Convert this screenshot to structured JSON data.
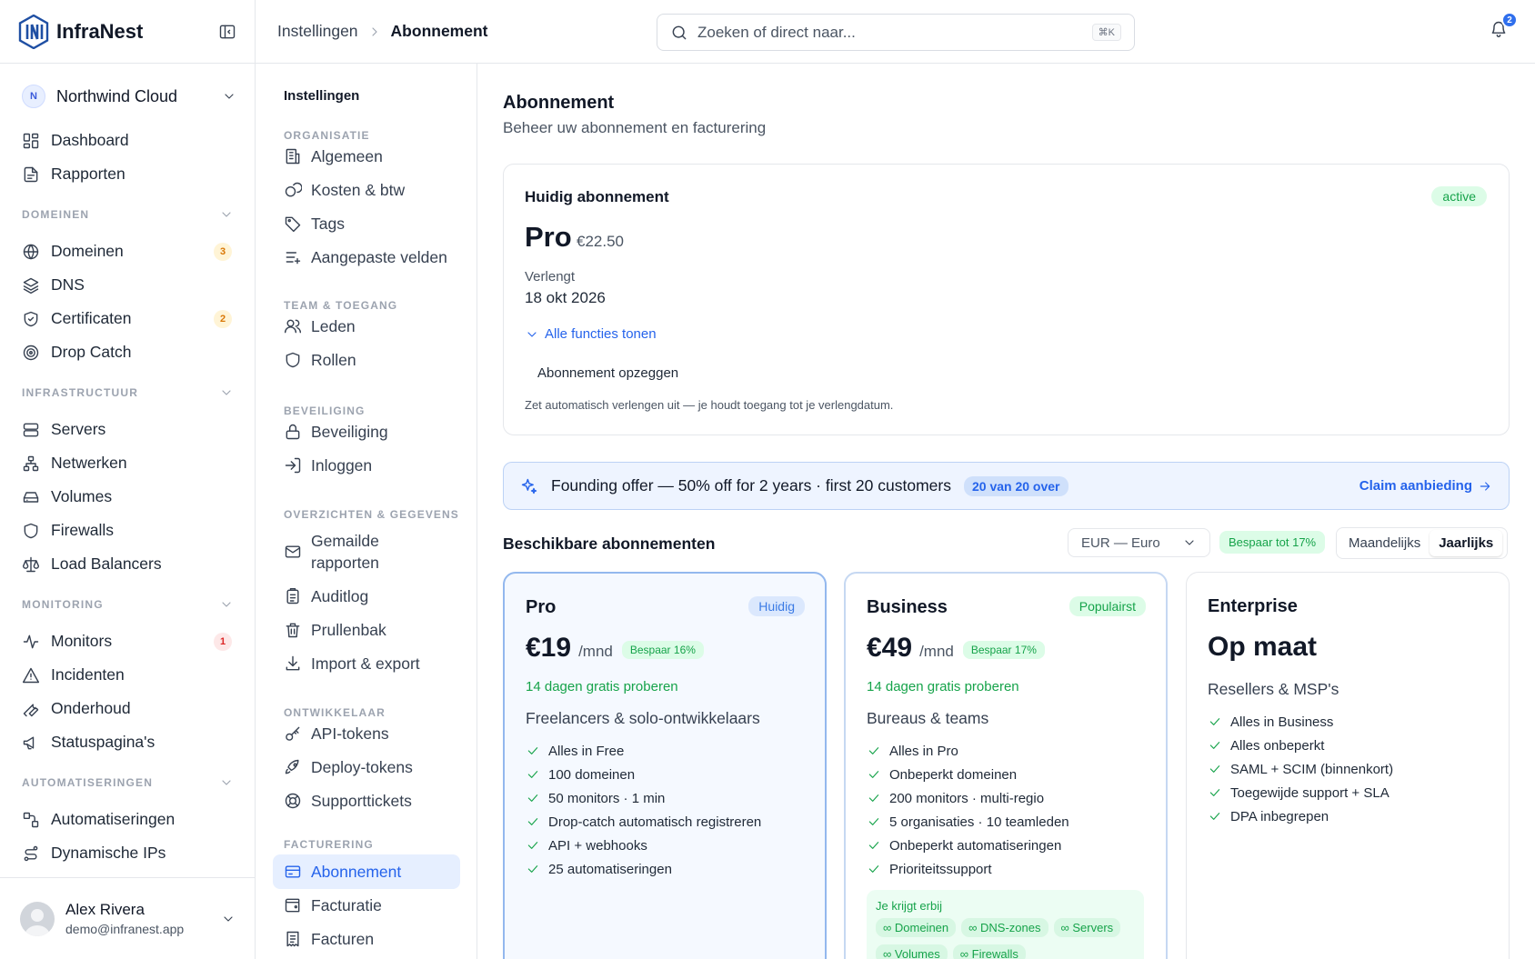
{
  "app": {
    "name": "InfraNest"
  },
  "org": {
    "initial": "N",
    "name": "Northwind Cloud"
  },
  "sidebar": {
    "top": [
      {
        "label": "Dashboard",
        "icon": "dashboard-icon"
      },
      {
        "label": "Rapporten",
        "icon": "report-icon"
      }
    ],
    "sections": [
      {
        "title": "DOMEINEN",
        "items": [
          {
            "label": "Domeinen",
            "icon": "globe-icon",
            "count": "3",
            "count_color": "orange"
          },
          {
            "label": "DNS",
            "icon": "layers-icon"
          },
          {
            "label": "Certificaten",
            "icon": "shield-check-icon",
            "count": "2",
            "count_color": "orange"
          },
          {
            "label": "Drop Catch",
            "icon": "target-icon"
          }
        ]
      },
      {
        "title": "INFRASTRUCTUUR",
        "items": [
          {
            "label": "Servers",
            "icon": "server-icon"
          },
          {
            "label": "Netwerken",
            "icon": "network-icon"
          },
          {
            "label": "Volumes",
            "icon": "hard-drive-icon"
          },
          {
            "label": "Firewalls",
            "icon": "shield-icon"
          },
          {
            "label": "Load Balancers",
            "icon": "scale-icon"
          }
        ]
      },
      {
        "title": "MONITORING",
        "items": [
          {
            "label": "Monitors",
            "icon": "activity-icon",
            "count": "1",
            "count_color": "red"
          },
          {
            "label": "Incidenten",
            "icon": "alert-triangle-icon"
          },
          {
            "label": "Onderhoud",
            "icon": "wrench-icon"
          },
          {
            "label": "Statuspagina's",
            "icon": "megaphone-icon"
          }
        ]
      },
      {
        "title": "AUTOMATISERINGEN",
        "items": [
          {
            "label": "Automatiseringen",
            "icon": "workflow-icon"
          },
          {
            "label": "Dynamische IPs",
            "icon": "route-icon"
          }
        ]
      }
    ]
  },
  "user": {
    "name": "Alex Rivera",
    "email": "demo@infranest.app"
  },
  "header": {
    "breadcrumb": [
      "Instellingen",
      "Abonnement"
    ],
    "search_placeholder": "Zoeken of direct naar...",
    "search_kbd": "⌘K",
    "notifications": "2"
  },
  "subnav": {
    "title": "Instellingen",
    "sections": [
      {
        "title": "ORGANISATIE",
        "items": [
          {
            "label": "Algemeen",
            "icon": "building-icon"
          },
          {
            "label": "Kosten & btw",
            "icon": "coins-icon"
          },
          {
            "label": "Tags",
            "icon": "tag-icon"
          },
          {
            "label": "Aangepaste velden",
            "icon": "list-plus-icon"
          }
        ]
      },
      {
        "title": "TEAM & TOEGANG",
        "items": [
          {
            "label": "Leden",
            "icon": "users-icon"
          },
          {
            "label": "Rollen",
            "icon": "shield-icon"
          }
        ]
      },
      {
        "title": "BEVEILIGING",
        "items": [
          {
            "label": "Beveiliging",
            "icon": "lock-icon"
          },
          {
            "label": "Inloggen",
            "icon": "login-icon"
          }
        ]
      },
      {
        "title": "OVERZICHTEN & GEGEVENS",
        "items": [
          {
            "label": "Gemailde rapporten",
            "icon": "mail-icon"
          },
          {
            "label": "Auditlog",
            "icon": "clipboard-icon"
          },
          {
            "label": "Prullenbak",
            "icon": "trash-icon"
          },
          {
            "label": "Import & export",
            "icon": "download-icon"
          }
        ]
      },
      {
        "title": "ONTWIKKELAAR",
        "items": [
          {
            "label": "API-tokens",
            "icon": "key-icon"
          },
          {
            "label": "Deploy-tokens",
            "icon": "rocket-icon"
          },
          {
            "label": "Supporttickets",
            "icon": "lifebuoy-icon"
          }
        ]
      },
      {
        "title": "FACTURERING",
        "items": [
          {
            "label": "Abonnement",
            "icon": "credit-card-icon",
            "active": true
          },
          {
            "label": "Facturatie",
            "icon": "wallet-icon"
          },
          {
            "label": "Facturen",
            "icon": "receipt-icon"
          }
        ]
      }
    ]
  },
  "main": {
    "title": "Abonnement",
    "subtitle": "Beheer uw abonnement en facturering",
    "current": {
      "heading": "Huidig abonnement",
      "status": "active",
      "plan": "Pro",
      "price": "€22.50",
      "renew_label": "Verlengt",
      "renew_date": "18 okt 2026",
      "show_features": "Alle functies tonen",
      "cancel_label": "Abonnement opzeggen",
      "cancel_help": "Zet automatisch verlengen uit — je houdt toegang tot je verlengdatum."
    },
    "offer": {
      "text": "Founding offer — 50% off for 2 years · first 20 customers",
      "remaining": "20 van 20 over",
      "claim": "Claim aanbieding"
    },
    "available_title": "Beschikbare abonnementen",
    "currency": "EUR — Euro",
    "save_up_to": "Bespaar tot 17%",
    "billing_toggle": {
      "monthly": "Maandelijks",
      "yearly": "Jaarlijks",
      "selected": "yearly"
    },
    "plans": [
      {
        "name": "Pro",
        "tag": "Huidig",
        "price": "€19",
        "per": "/mnd",
        "save": "Bespaar 16%",
        "trial": "14 dagen gratis proberen",
        "audience": "Freelancers & solo-ontwikkelaars",
        "features": [
          "Alles in Free",
          "100 domeinen",
          "50 monitors · 1 min",
          "Drop-catch automatisch registreren",
          "API + webhooks",
          "25 automatiseringen"
        ]
      },
      {
        "name": "Business",
        "tag": "Populairst",
        "price": "€49",
        "per": "/mnd",
        "save": "Bespaar 17%",
        "trial": "14 dagen gratis proberen",
        "audience": "Bureaus & teams",
        "features": [
          "Alles in Pro",
          "Onbeperkt domeinen",
          "200 monitors · multi-regio",
          "5 organisaties · 10 teamleden",
          "Onbeperkt automatiseringen",
          "Prioriteitssupport"
        ],
        "extra_title": "Je krijgt erbij",
        "extras": [
          "∞ Domeinen",
          "∞ DNS-zones",
          "∞ Servers",
          "∞ Volumes",
          "∞ Firewalls"
        ]
      },
      {
        "name": "Enterprise",
        "price": "Op maat",
        "audience": "Resellers & MSP's",
        "features": [
          "Alles in Business",
          "Alles onbeperkt",
          "SAML + SCIM (binnenkort)",
          "Toegewijde support + SLA",
          "DPA inbegrepen"
        ]
      }
    ]
  }
}
